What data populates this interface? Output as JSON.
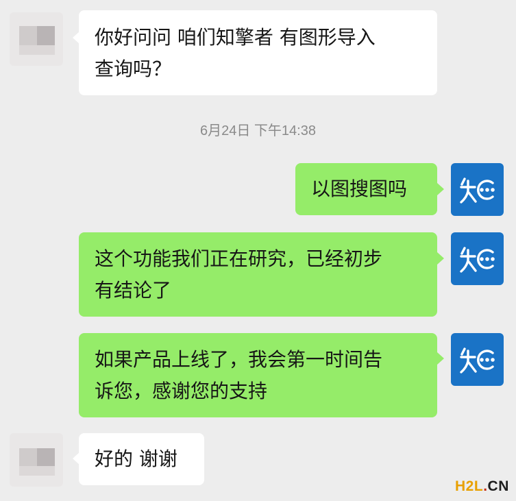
{
  "chat": {
    "timestamp": "6月24日 下午14:38",
    "messages": [
      {
        "sender": "other",
        "lines": [
          "你好问问 咱们知擎者 有图形导入",
          "查询吗？"
        ]
      },
      {
        "sender": "self",
        "lines": [
          "以图搜图吗"
        ]
      },
      {
        "sender": "self",
        "lines": [
          "这个功能我们正在研究，已经初步",
          "有结论了"
        ]
      },
      {
        "sender": "self",
        "lines": [
          "如果产品上线了，我会第一时间告",
          "诉您，感谢您的支持"
        ]
      },
      {
        "sender": "other",
        "lines": [
          "好的 谢谢"
        ]
      }
    ]
  },
  "watermark": {
    "part1": "H2L",
    "part2": ".",
    "part3": "CN"
  },
  "colors": {
    "background": "#ededed",
    "self_bubble": "#95ec69",
    "other_bubble": "#ffffff",
    "brand_avatar": "#1a73c6"
  },
  "icons": {
    "other_avatar": "blurred-avatar-icon",
    "self_avatar": "zhi-logo-icon"
  }
}
